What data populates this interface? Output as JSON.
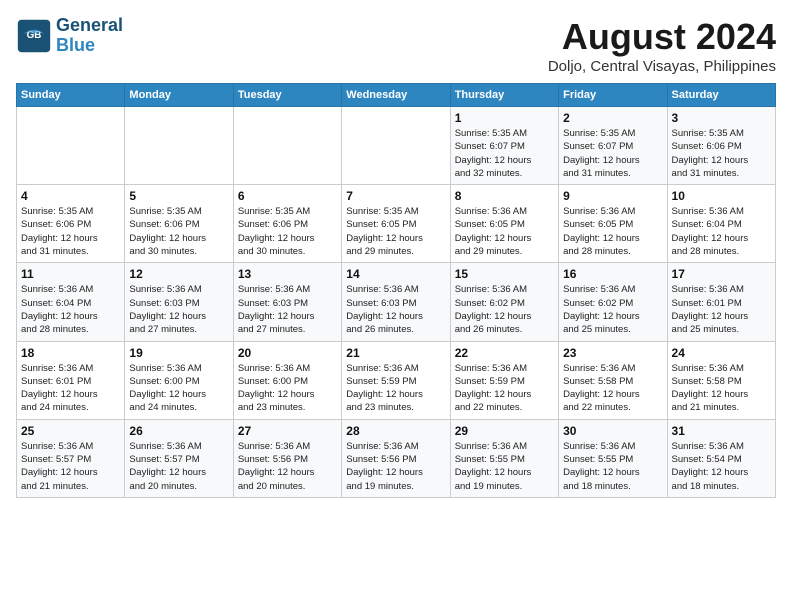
{
  "header": {
    "logo_line1": "General",
    "logo_line2": "Blue",
    "month": "August 2024",
    "location": "Doljo, Central Visayas, Philippines"
  },
  "days_of_week": [
    "Sunday",
    "Monday",
    "Tuesday",
    "Wednesday",
    "Thursday",
    "Friday",
    "Saturday"
  ],
  "weeks": [
    [
      {
        "day": "",
        "info": ""
      },
      {
        "day": "",
        "info": ""
      },
      {
        "day": "",
        "info": ""
      },
      {
        "day": "",
        "info": ""
      },
      {
        "day": "1",
        "info": "Sunrise: 5:35 AM\nSunset: 6:07 PM\nDaylight: 12 hours\nand 32 minutes."
      },
      {
        "day": "2",
        "info": "Sunrise: 5:35 AM\nSunset: 6:07 PM\nDaylight: 12 hours\nand 31 minutes."
      },
      {
        "day": "3",
        "info": "Sunrise: 5:35 AM\nSunset: 6:06 PM\nDaylight: 12 hours\nand 31 minutes."
      }
    ],
    [
      {
        "day": "4",
        "info": "Sunrise: 5:35 AM\nSunset: 6:06 PM\nDaylight: 12 hours\nand 31 minutes."
      },
      {
        "day": "5",
        "info": "Sunrise: 5:35 AM\nSunset: 6:06 PM\nDaylight: 12 hours\nand 30 minutes."
      },
      {
        "day": "6",
        "info": "Sunrise: 5:35 AM\nSunset: 6:06 PM\nDaylight: 12 hours\nand 30 minutes."
      },
      {
        "day": "7",
        "info": "Sunrise: 5:35 AM\nSunset: 6:05 PM\nDaylight: 12 hours\nand 29 minutes."
      },
      {
        "day": "8",
        "info": "Sunrise: 5:36 AM\nSunset: 6:05 PM\nDaylight: 12 hours\nand 29 minutes."
      },
      {
        "day": "9",
        "info": "Sunrise: 5:36 AM\nSunset: 6:05 PM\nDaylight: 12 hours\nand 28 minutes."
      },
      {
        "day": "10",
        "info": "Sunrise: 5:36 AM\nSunset: 6:04 PM\nDaylight: 12 hours\nand 28 minutes."
      }
    ],
    [
      {
        "day": "11",
        "info": "Sunrise: 5:36 AM\nSunset: 6:04 PM\nDaylight: 12 hours\nand 28 minutes."
      },
      {
        "day": "12",
        "info": "Sunrise: 5:36 AM\nSunset: 6:03 PM\nDaylight: 12 hours\nand 27 minutes."
      },
      {
        "day": "13",
        "info": "Sunrise: 5:36 AM\nSunset: 6:03 PM\nDaylight: 12 hours\nand 27 minutes."
      },
      {
        "day": "14",
        "info": "Sunrise: 5:36 AM\nSunset: 6:03 PM\nDaylight: 12 hours\nand 26 minutes."
      },
      {
        "day": "15",
        "info": "Sunrise: 5:36 AM\nSunset: 6:02 PM\nDaylight: 12 hours\nand 26 minutes."
      },
      {
        "day": "16",
        "info": "Sunrise: 5:36 AM\nSunset: 6:02 PM\nDaylight: 12 hours\nand 25 minutes."
      },
      {
        "day": "17",
        "info": "Sunrise: 5:36 AM\nSunset: 6:01 PM\nDaylight: 12 hours\nand 25 minutes."
      }
    ],
    [
      {
        "day": "18",
        "info": "Sunrise: 5:36 AM\nSunset: 6:01 PM\nDaylight: 12 hours\nand 24 minutes."
      },
      {
        "day": "19",
        "info": "Sunrise: 5:36 AM\nSunset: 6:00 PM\nDaylight: 12 hours\nand 24 minutes."
      },
      {
        "day": "20",
        "info": "Sunrise: 5:36 AM\nSunset: 6:00 PM\nDaylight: 12 hours\nand 23 minutes."
      },
      {
        "day": "21",
        "info": "Sunrise: 5:36 AM\nSunset: 5:59 PM\nDaylight: 12 hours\nand 23 minutes."
      },
      {
        "day": "22",
        "info": "Sunrise: 5:36 AM\nSunset: 5:59 PM\nDaylight: 12 hours\nand 22 minutes."
      },
      {
        "day": "23",
        "info": "Sunrise: 5:36 AM\nSunset: 5:58 PM\nDaylight: 12 hours\nand 22 minutes."
      },
      {
        "day": "24",
        "info": "Sunrise: 5:36 AM\nSunset: 5:58 PM\nDaylight: 12 hours\nand 21 minutes."
      }
    ],
    [
      {
        "day": "25",
        "info": "Sunrise: 5:36 AM\nSunset: 5:57 PM\nDaylight: 12 hours\nand 21 minutes."
      },
      {
        "day": "26",
        "info": "Sunrise: 5:36 AM\nSunset: 5:57 PM\nDaylight: 12 hours\nand 20 minutes."
      },
      {
        "day": "27",
        "info": "Sunrise: 5:36 AM\nSunset: 5:56 PM\nDaylight: 12 hours\nand 20 minutes."
      },
      {
        "day": "28",
        "info": "Sunrise: 5:36 AM\nSunset: 5:56 PM\nDaylight: 12 hours\nand 19 minutes."
      },
      {
        "day": "29",
        "info": "Sunrise: 5:36 AM\nSunset: 5:55 PM\nDaylight: 12 hours\nand 19 minutes."
      },
      {
        "day": "30",
        "info": "Sunrise: 5:36 AM\nSunset: 5:55 PM\nDaylight: 12 hours\nand 18 minutes."
      },
      {
        "day": "31",
        "info": "Sunrise: 5:36 AM\nSunset: 5:54 PM\nDaylight: 12 hours\nand 18 minutes."
      }
    ]
  ]
}
